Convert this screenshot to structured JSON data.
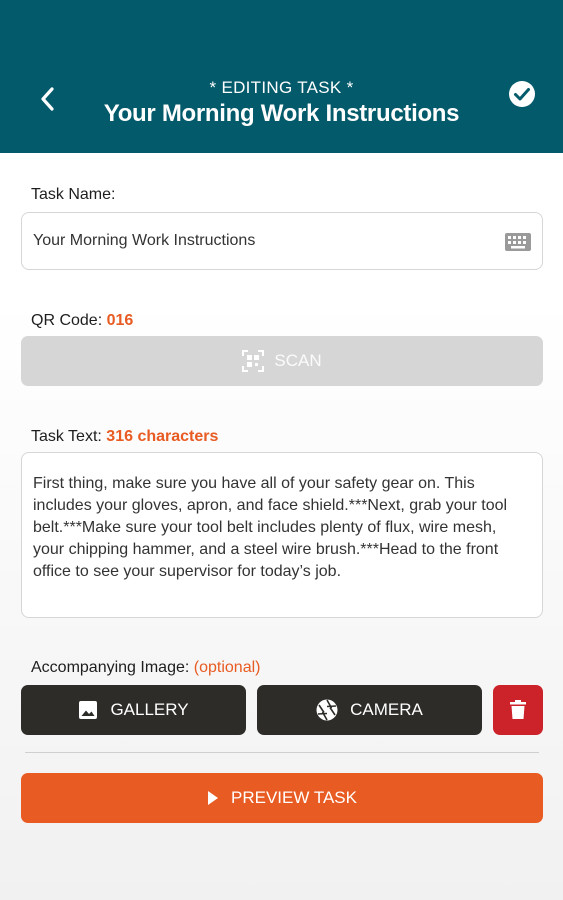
{
  "header": {
    "subtitle": "* EDITING TASK *",
    "title": "Your Morning Work Instructions",
    "back_icon": "chevron-left-icon",
    "confirm_icon": "check-circle-icon",
    "background": "#035a6b"
  },
  "task_name": {
    "label": "Task Name:",
    "value": "Your Morning Work Instructions",
    "icon": "keyboard-icon"
  },
  "qr_code": {
    "label": "QR Code:",
    "value": "016",
    "scan_label": "SCAN",
    "scan_icon": "qr-scan-icon"
  },
  "task_text": {
    "label": "Task Text:",
    "count": "316 characters",
    "value": "First thing, make sure you have all of your safety gear on.  This includes your gloves, apron, and face shield.***Next, grab your tool belt.***Make sure your tool belt includes plenty of flux, wire mesh, your chipping hammer, and a steel wire brush.***Head to the front office to see your supervisor for today’s job."
  },
  "image": {
    "label": "Accompanying Image:",
    "optional": "(optional)",
    "gallery_label": "GALLERY",
    "camera_label": "CAMERA",
    "gallery_icon": "image-icon",
    "camera_icon": "camera-aperture-icon",
    "delete_icon": "trash-icon"
  },
  "preview": {
    "label": "PREVIEW TASK",
    "icon": "play-icon"
  },
  "colors": {
    "accent": "#e85b22",
    "dark_button": "#2d2c28",
    "delete": "#cc2229",
    "disabled": "#d6d6d6"
  }
}
